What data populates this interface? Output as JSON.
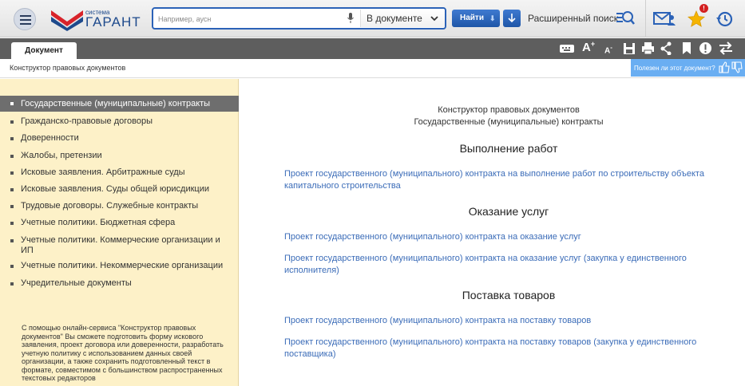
{
  "header": {
    "logo_small": "система",
    "logo_big": "ГАРАНТ",
    "search_placeholder": "Например, аусн",
    "search_scope": "В документе",
    "find_label": "Найти",
    "advanced_search_label": "Расширенный поиск",
    "notification_count": "!"
  },
  "tabs": {
    "document_tab": "Документ"
  },
  "doc_header": {
    "breadcrumb": "Конструктор правовых документов",
    "useful_question": "Полезен ли этот документ?"
  },
  "sidebar": {
    "items": [
      {
        "label": "Государственные (муниципальные) контракты",
        "active": true
      },
      {
        "label": "Гражданско-правовые договоры"
      },
      {
        "label": "Доверенности"
      },
      {
        "label": "Жалобы, претензии"
      },
      {
        "label": "Исковые заявления. Арбитражные суды"
      },
      {
        "label": "Исковые заявления. Суды общей юрисдикции"
      },
      {
        "label": "Трудовые договоры. Служебные контракты"
      },
      {
        "label": "Учетные политики. Бюджетная сфера"
      },
      {
        "label": "Учетные политики. Коммерческие организации и ИП"
      },
      {
        "label": "Учетные политики. Некоммерческие организации"
      },
      {
        "label": "Учредительные документы"
      }
    ],
    "description": "С помощью онлайн-сервиса \"Конструктор правовых документов\" Вы сможете подготовить форму искового заявления, проект договора или доверенности, разработать учетную политику с использованием данных своей организации, а также сохранить подготовленный текст в формате, совместимом с большинством распространенных текстовых редакторов"
  },
  "main": {
    "heading_line1": "Конструктор правовых документов",
    "heading_line2": "Государственные (муниципальные) контракты",
    "sections": [
      {
        "title": "Выполнение работ",
        "links": [
          "Проект государственного (муниципального) контракта на выполнение работ по строительству объекта капитального строительства"
        ]
      },
      {
        "title": "Оказание услуг",
        "links": [
          "Проект государственного (муниципального) контракта на оказание услуг",
          "Проект государственного (муниципального) контракта на оказание услуг (закупка у единственного исполнителя)"
        ]
      },
      {
        "title": "Поставка товаров",
        "links": [
          "Проект государственного (муниципального) контракта на поставку товаров",
          "Проект государственного (муниципального) контракта на поставку товаров (закупка у единственного поставщика)"
        ]
      }
    ]
  },
  "colors": {
    "accent_blue": "#2b62b7",
    "link": "#3b6cb8",
    "sidebar_bg": "#fdf1c8",
    "active_item_bg": "#6e6e6e",
    "useful_bar": "#6aaef2"
  }
}
